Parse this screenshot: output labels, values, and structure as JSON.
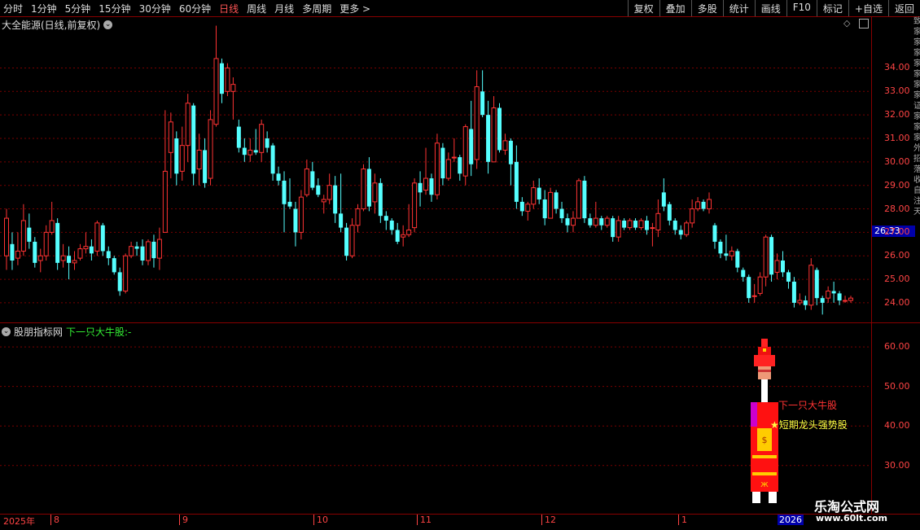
{
  "toolbar": {
    "timeframes": [
      "分时",
      "1分钟",
      "5分钟",
      "15分钟",
      "30分钟",
      "60分钟",
      "日线",
      "周线",
      "月线",
      "多周期",
      "更多 >"
    ],
    "active_timeframe": "日线",
    "right_buttons": [
      "复权",
      "叠加",
      "多股",
      "统计",
      "画线",
      "F10",
      "标记",
      "+自选",
      "返回"
    ]
  },
  "main_chart": {
    "title": "大全能源(日线,前复权)",
    "current_price": "26.33",
    "y_ticks": [
      "34.00",
      "33.00",
      "32.00",
      "31.00",
      "30.00",
      "29.00",
      "28.00",
      "27.00",
      "26.00",
      "25.00",
      "24.00"
    ],
    "colors": {
      "up": "#ff3333",
      "down": "#55ffff",
      "grid": "#7a0000"
    }
  },
  "indicator": {
    "name": "股朋指标网",
    "value_label": "下一只大牛股:-",
    "y_ticks": [
      "60.00",
      "50.00",
      "40.00",
      "30.00"
    ],
    "figure_label_1": "下一只大牛股",
    "figure_label_2": "★短期龙头强势股"
  },
  "date_axis": {
    "year": "2025年",
    "months": [
      "8",
      "9",
      "10",
      "11",
      "12",
      "1"
    ],
    "end_label": "2026"
  },
  "watermark": {
    "name": "乐淘公式网",
    "url": "www.60lt.com"
  },
  "side_strip_text": "致家家家家家家家证家家家外招落收自注天",
  "chart_data": {
    "type": "candlestick",
    "ylim": [
      23.2,
      36.2
    ],
    "candles": [
      [
        26.0,
        27.6,
        25.4,
        28.0
      ],
      [
        26.5,
        25.8,
        25.4,
        27.0
      ],
      [
        25.9,
        26.2,
        25.6,
        27.0
      ],
      [
        26.2,
        27.5,
        26.0,
        28.2
      ],
      [
        27.2,
        26.6,
        26.3,
        27.8
      ],
      [
        26.6,
        25.7,
        25.5,
        26.8
      ],
      [
        25.8,
        26.0,
        25.3,
        26.3
      ],
      [
        26.0,
        27.0,
        25.8,
        27.3
      ],
      [
        27.0,
        27.5,
        26.9,
        28.3
      ],
      [
        27.4,
        25.7,
        25.4,
        27.6
      ],
      [
        25.8,
        26.0,
        25.5,
        26.5
      ],
      [
        26.0,
        25.7,
        25.0,
        26.4
      ],
      [
        25.7,
        25.8,
        25.4,
        26.2
      ],
      [
        25.9,
        26.3,
        25.8,
        26.5
      ],
      [
        26.3,
        26.4,
        26.1,
        27.0
      ],
      [
        26.4,
        26.1,
        25.8,
        26.7
      ],
      [
        26.2,
        27.4,
        26.0,
        27.5
      ],
      [
        27.3,
        26.2,
        26.0,
        27.4
      ],
      [
        26.2,
        25.9,
        25.6,
        26.4
      ],
      [
        25.9,
        25.3,
        25.2,
        26.0
      ],
      [
        25.3,
        24.5,
        24.3,
        25.5
      ],
      [
        24.5,
        26.0,
        24.4,
        26.1
      ],
      [
        26.0,
        26.4,
        25.9,
        26.6
      ],
      [
        26.4,
        26.3,
        26.0,
        26.6
      ],
      [
        26.4,
        25.8,
        25.6,
        26.7
      ],
      [
        25.8,
        26.6,
        25.6,
        26.7
      ],
      [
        26.6,
        25.9,
        25.5,
        26.9
      ],
      [
        25.9,
        26.7,
        25.4,
        27.2
      ],
      [
        27.0,
        29.6,
        28.9,
        32.2
      ],
      [
        30.4,
        31.7,
        29.3,
        32.1
      ],
      [
        31.0,
        29.5,
        29.0,
        31.3
      ],
      [
        29.6,
        30.7,
        29.2,
        31.5
      ],
      [
        30.7,
        32.5,
        30.0,
        32.9
      ],
      [
        32.4,
        29.5,
        29.0,
        32.5
      ],
      [
        29.7,
        30.5,
        29.0,
        31.2
      ],
      [
        30.5,
        29.1,
        28.9,
        31.0
      ],
      [
        29.3,
        31.8,
        29.0,
        32.2
      ],
      [
        31.6,
        34.4,
        31.5,
        35.8
      ],
      [
        34.2,
        32.9,
        32.5,
        34.4
      ],
      [
        33.0,
        34.0,
        32.8,
        34.2
      ],
      [
        33.0,
        33.3,
        31.8,
        33.6
      ],
      [
        31.5,
        30.6,
        30.4,
        31.8
      ],
      [
        30.6,
        30.3,
        30.0,
        31.0
      ],
      [
        30.3,
        30.5,
        30.0,
        31.0
      ],
      [
        30.5,
        30.4,
        30.3,
        31.4
      ],
      [
        30.4,
        31.6,
        30.0,
        31.8
      ],
      [
        31.0,
        30.6,
        30.4,
        31.3
      ],
      [
        30.7,
        29.5,
        29.2,
        30.8
      ],
      [
        29.5,
        29.2,
        29.0,
        29.8
      ],
      [
        29.2,
        28.2,
        27.0,
        29.6
      ],
      [
        28.3,
        28.1,
        28.0,
        29.3
      ],
      [
        28.0,
        27.0,
        26.4,
        28.3
      ],
      [
        27.0,
        28.5,
        26.7,
        28.8
      ],
      [
        28.6,
        29.7,
        28.5,
        30.1
      ],
      [
        29.6,
        28.9,
        28.8,
        30.0
      ],
      [
        29.0,
        28.6,
        28.5,
        29.3
      ],
      [
        28.3,
        28.4,
        27.8,
        28.6
      ],
      [
        28.4,
        29.0,
        28.2,
        29.5
      ],
      [
        29.0,
        27.8,
        27.4,
        29.4
      ],
      [
        27.8,
        27.2,
        27.0,
        29.5
      ],
      [
        27.2,
        26.0,
        25.8,
        27.4
      ],
      [
        26.0,
        27.3,
        25.9,
        27.6
      ],
      [
        27.3,
        28.0,
        27.0,
        28.2
      ],
      [
        28.0,
        29.7,
        27.9,
        29.9
      ],
      [
        29.7,
        28.1,
        27.9,
        30.2
      ],
      [
        28.3,
        29.1,
        27.8,
        29.5
      ],
      [
        29.1,
        27.7,
        27.4,
        29.3
      ],
      [
        27.7,
        27.5,
        27.1,
        27.9
      ],
      [
        27.5,
        27.1,
        26.9,
        27.6
      ],
      [
        27.1,
        26.6,
        26.5,
        27.4
      ],
      [
        26.8,
        26.9,
        26.4,
        27.3
      ],
      [
        26.9,
        27.1,
        26.8,
        28.2
      ],
      [
        27.2,
        29.1,
        27.0,
        29.3
      ],
      [
        29.1,
        28.7,
        28.1,
        29.6
      ],
      [
        28.8,
        29.3,
        28.6,
        30.6
      ],
      [
        29.3,
        28.6,
        28.3,
        29.5
      ],
      [
        28.6,
        30.8,
        28.4,
        31.2
      ],
      [
        30.6,
        29.3,
        29.0,
        30.8
      ],
      [
        29.3,
        30.1,
        29.2,
        30.4
      ],
      [
        30.2,
        30.2,
        30.0,
        31.0
      ],
      [
        30.2,
        29.5,
        29.2,
        30.3
      ],
      [
        29.4,
        31.5,
        29.0,
        31.6
      ],
      [
        31.4,
        29.9,
        29.4,
        32.6
      ],
      [
        30.1,
        33.2,
        29.7,
        33.9
      ],
      [
        33.0,
        32.0,
        31.9,
        33.9
      ],
      [
        32.0,
        30.0,
        29.5,
        32.6
      ],
      [
        30.0,
        32.3,
        30.0,
        32.8
      ],
      [
        32.3,
        30.5,
        30.4,
        32.5
      ],
      [
        30.5,
        30.9,
        30.3,
        31.2
      ],
      [
        30.9,
        29.9,
        29.0,
        31.0
      ],
      [
        30.0,
        28.3,
        28.0,
        30.7
      ],
      [
        28.3,
        27.9,
        27.7,
        28.5
      ],
      [
        27.9,
        28.2,
        27.5,
        28.3
      ],
      [
        28.2,
        28.9,
        28.0,
        29.2
      ],
      [
        28.9,
        28.4,
        28.2,
        29.3
      ],
      [
        28.4,
        27.6,
        27.3,
        28.8
      ],
      [
        27.6,
        28.7,
        27.6,
        28.9
      ],
      [
        28.7,
        28.0,
        27.8,
        28.8
      ],
      [
        28.0,
        27.6,
        27.4,
        28.3
      ],
      [
        27.6,
        27.3,
        27.0,
        27.8
      ],
      [
        27.3,
        27.6,
        27.0,
        27.9
      ],
      [
        27.6,
        29.2,
        27.6,
        29.3
      ],
      [
        29.2,
        27.6,
        27.4,
        29.4
      ],
      [
        27.6,
        27.3,
        27.2,
        27.8
      ],
      [
        27.3,
        27.6,
        27.2,
        28.3
      ],
      [
        27.6,
        27.3,
        27.1,
        27.7
      ],
      [
        27.3,
        27.6,
        27.2,
        27.7
      ],
      [
        27.6,
        26.8,
        26.6,
        27.7
      ],
      [
        26.8,
        27.5,
        26.6,
        27.7
      ],
      [
        27.5,
        27.2,
        27.1,
        27.6
      ],
      [
        27.2,
        27.5,
        27.1,
        27.6
      ],
      [
        27.5,
        27.2,
        27.1,
        27.6
      ],
      [
        27.2,
        27.5,
        27.1,
        27.6
      ],
      [
        27.5,
        27.1,
        26.9,
        27.7
      ],
      [
        27.2,
        27.2,
        26.4,
        27.4
      ],
      [
        27.1,
        27.8,
        26.8,
        28.4
      ],
      [
        28.7,
        28.1,
        27.9,
        29.3
      ],
      [
        28.2,
        27.5,
        27.3,
        28.3
      ],
      [
        27.5,
        27.1,
        26.9,
        27.6
      ],
      [
        27.1,
        26.9,
        26.7,
        27.3
      ],
      [
        26.9,
        27.4,
        26.8,
        27.5
      ],
      [
        27.4,
        28.0,
        27.2,
        28.4
      ],
      [
        28.0,
        28.3,
        27.9,
        28.5
      ],
      [
        28.3,
        28.0,
        27.9,
        28.4
      ],
      [
        28.0,
        28.4,
        27.8,
        28.7
      ],
      [
        27.3,
        26.6,
        26.3,
        27.4
      ],
      [
        26.6,
        26.1,
        25.9,
        26.7
      ],
      [
        26.1,
        26.0,
        25.8,
        26.9
      ],
      [
        26.0,
        26.2,
        25.8,
        26.4
      ],
      [
        26.2,
        25.5,
        25.3,
        26.3
      ],
      [
        25.4,
        25.1,
        24.9,
        25.5
      ],
      [
        25.1,
        24.2,
        24.0,
        25.2
      ],
      [
        24.3,
        24.3,
        24.0,
        24.8
      ],
      [
        24.4,
        25.1,
        24.3,
        25.3
      ],
      [
        25.1,
        26.8,
        24.7,
        26.9
      ],
      [
        26.8,
        25.2,
        24.9,
        26.9
      ],
      [
        25.3,
        25.8,
        25.0,
        26.1
      ],
      [
        25.8,
        25.3,
        25.1,
        26.2
      ],
      [
        25.3,
        24.9,
        24.6,
        25.4
      ],
      [
        24.9,
        24.0,
        23.8,
        25.1
      ],
      [
        24.0,
        24.1,
        23.9,
        24.4
      ],
      [
        24.1,
        23.9,
        23.7,
        24.3
      ],
      [
        23.9,
        25.6,
        23.7,
        25.9
      ],
      [
        25.4,
        24.2,
        23.9,
        25.5
      ],
      [
        24.2,
        24.0,
        23.5,
        24.3
      ],
      [
        24.2,
        24.5,
        24.0,
        24.7
      ],
      [
        24.5,
        24.4,
        24.0,
        24.9
      ],
      [
        24.4,
        24.1,
        23.9,
        24.5
      ],
      [
        24.1,
        24.1,
        24.0,
        24.3
      ],
      [
        24.1,
        24.2,
        24.0,
        24.3
      ]
    ]
  }
}
